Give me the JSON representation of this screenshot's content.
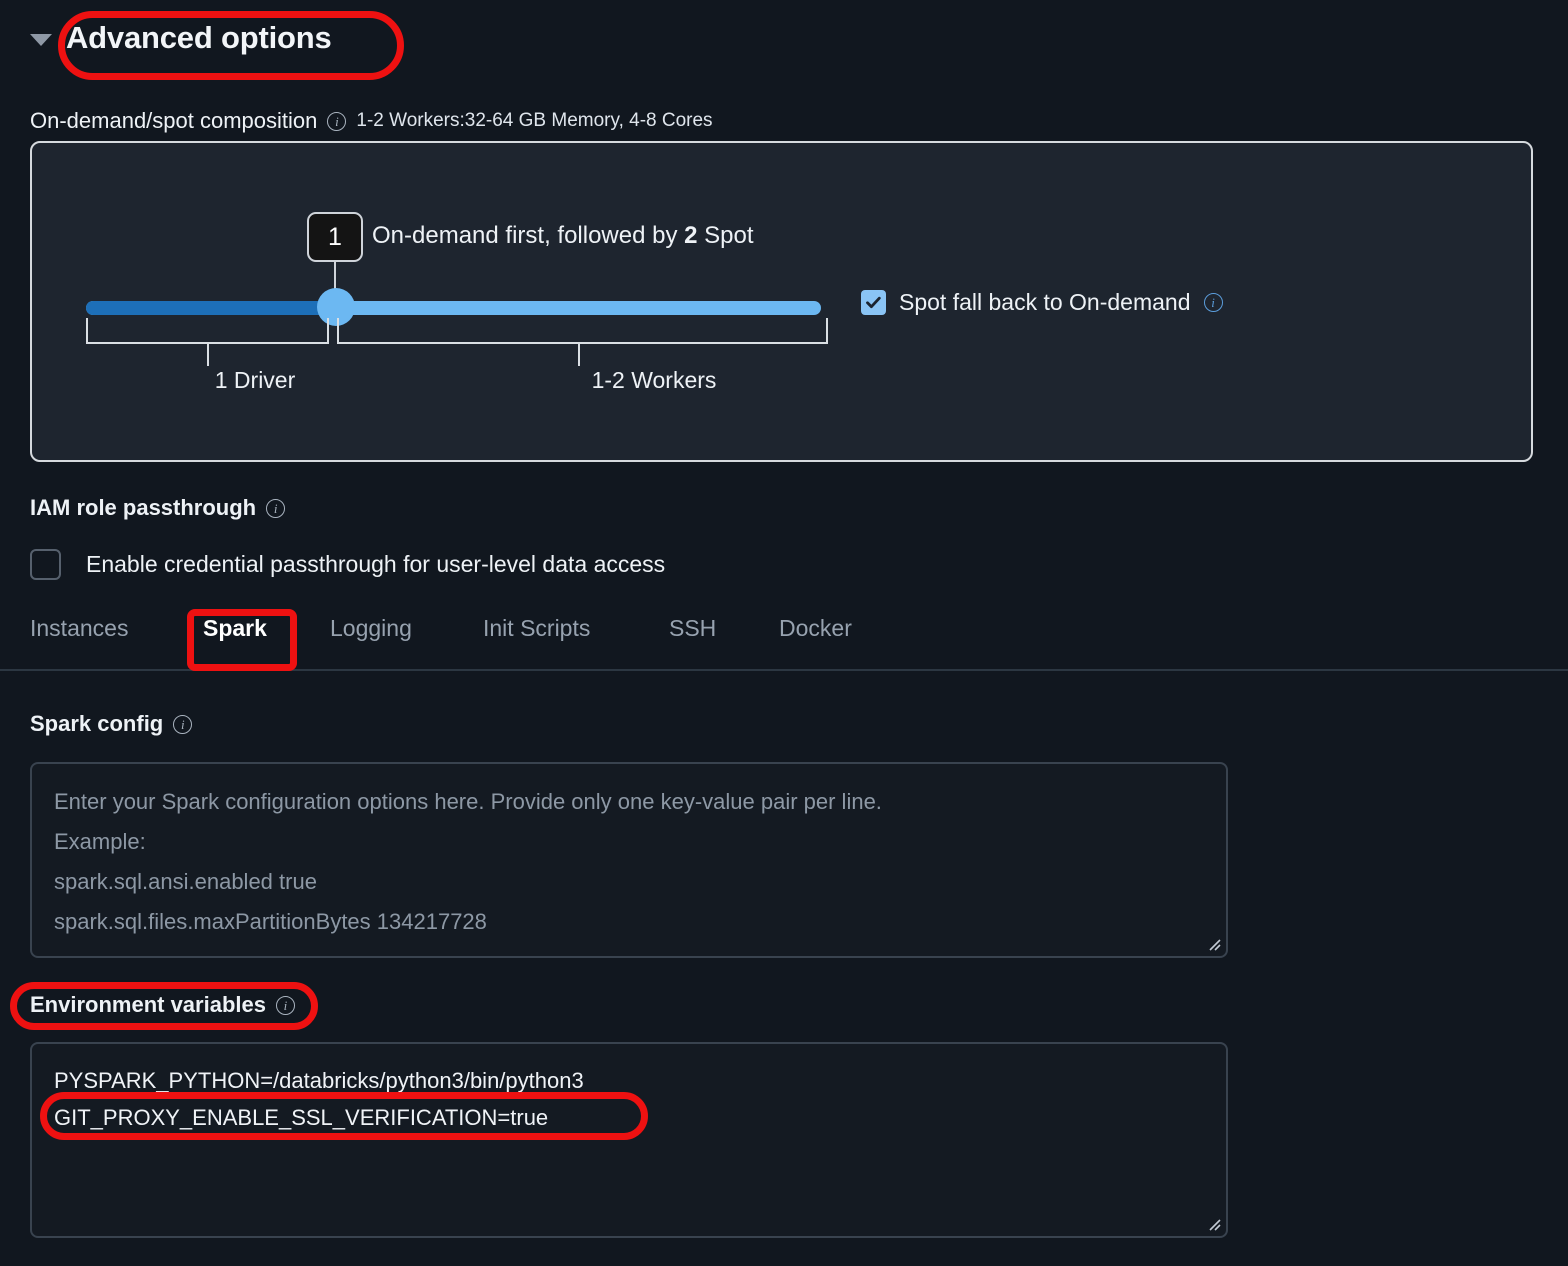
{
  "header": {
    "title": "Advanced options",
    "caret_icon": "caret-down-icon"
  },
  "composition": {
    "label": "On-demand/spot composition",
    "info_icon": "info-icon",
    "summary": "1-2 Workers:32-64 GB Memory, 4-8 Cores",
    "slider": {
      "value": "1",
      "description_prefix": "On-demand first, followed by ",
      "description_bold": "2",
      "description_suffix": " Spot",
      "min_label": "1 Driver",
      "max_label": "1-2 Workers",
      "fill_color": "#1d6fb8",
      "track_color": "#6cb8f2",
      "thumb_color": "#6cb8f2"
    },
    "spot_fallback": {
      "label": "Spot fall back to On-demand",
      "checked": true,
      "info_icon": "info-icon",
      "checkbox_color": "#8ac4f5"
    }
  },
  "iam": {
    "label": "IAM role passthrough",
    "info_icon": "info-icon",
    "checkbox_label": "Enable credential passthrough for user-level data access",
    "checked": false
  },
  "tabs": {
    "items": [
      {
        "label": "Instances",
        "active": false
      },
      {
        "label": "Spark",
        "active": true
      },
      {
        "label": "Logging",
        "active": false
      },
      {
        "label": "Init Scripts",
        "active": false
      },
      {
        "label": "SSH",
        "active": false
      },
      {
        "label": "Docker",
        "active": false
      }
    ],
    "active_underline_color": "#4a9ae0"
  },
  "spark_config": {
    "label": "Spark config",
    "info_icon": "info-icon",
    "value": "",
    "placeholder_lines": [
      "Enter your Spark configuration options here. Provide only one key-value pair per line.",
      "Example:",
      "spark.sql.ansi.enabled true",
      "spark.sql.files.maxPartitionBytes 134217728"
    ],
    "resize_icon": "resize-grip-icon"
  },
  "environment_variables": {
    "label": "Environment variables",
    "info_icon": "info-icon",
    "value_lines": [
      "PYSPARK_PYTHON=/databricks/python3/bin/python3",
      "GIT_PROXY_ENABLE_SSL_VERIFICATION=true"
    ],
    "resize_icon": "resize-grip-icon"
  },
  "annotations": {
    "color": "#ee1111",
    "items": [
      "advanced-options-highlight",
      "spark-tab-highlight",
      "environment-variables-label-highlight",
      "git-proxy-line-highlight"
    ]
  }
}
